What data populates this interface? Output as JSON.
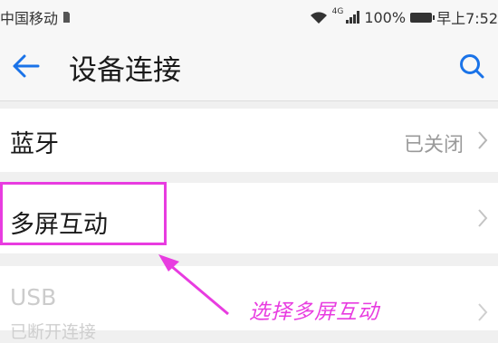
{
  "status_bar": {
    "carrier": "中国移动",
    "network": "4G",
    "battery": "100%",
    "time": "早上7:52"
  },
  "app_bar": {
    "back_icon": "arrow-left-icon",
    "title": "设备连接",
    "search_icon": "search-icon",
    "accent_color": "#1a73e8"
  },
  "settings": {
    "bluetooth": {
      "label": "蓝牙",
      "status": "已关闭"
    },
    "multi_screen": {
      "label": "多屏互动"
    },
    "usb": {
      "label": "USB",
      "sublabel": "已断开连接"
    }
  },
  "annotation": {
    "text": "选择多屏互动",
    "color": "#e83ce0"
  }
}
